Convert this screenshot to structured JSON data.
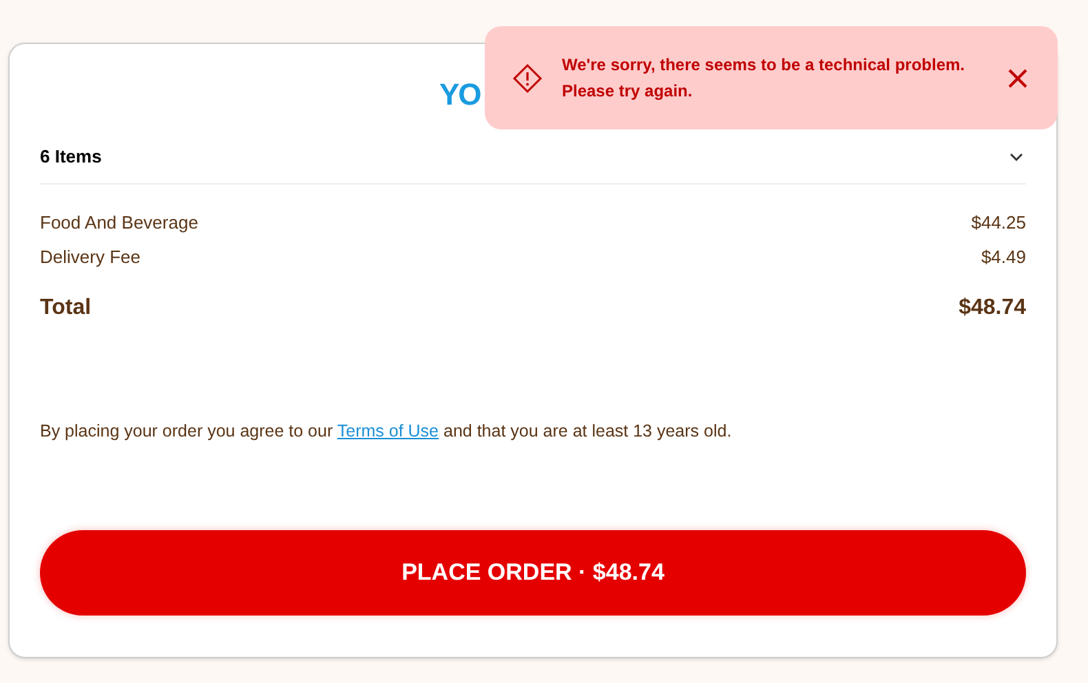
{
  "card": {
    "title": "YO",
    "items_summary": {
      "label": "6 Items"
    },
    "lines": [
      {
        "label": "Food And Beverage",
        "amount": "$44.25"
      },
      {
        "label": "Delivery Fee",
        "amount": "$4.49"
      }
    ],
    "total": {
      "label": "Total",
      "amount": "$48.74"
    },
    "terms": {
      "before": "By placing your order you agree to our",
      "link": "Terms of Use",
      "after": "and that you are at least 13 years old."
    },
    "button": "PLACE ORDER · $48.74"
  },
  "toast": {
    "message": "We're sorry, there seems to be a technical problem.",
    "message_2": "Please try again."
  }
}
